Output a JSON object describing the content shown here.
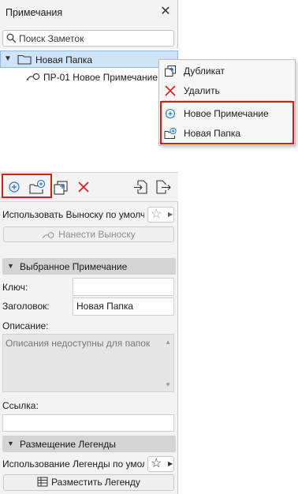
{
  "panel": {
    "title": "Примечания",
    "close_icon": "close-icon",
    "search": {
      "placeholder": "Поиск Заметок",
      "value": ""
    }
  },
  "tree": {
    "folder": {
      "label": "Новая Папка",
      "expanded": true,
      "selected": true
    },
    "note": {
      "label": "ПР-01 Новое Примечание"
    }
  },
  "context_menu": {
    "items": [
      {
        "label": "Дубликат",
        "icon": "duplicate-icon"
      },
      {
        "label": "Удалить",
        "icon": "delete-icon"
      },
      {
        "label": "Новое Примечание",
        "icon": "new-note-icon"
      },
      {
        "label": "Новая Папка",
        "icon": "new-folder-icon"
      }
    ]
  },
  "toolbar": {
    "icons": [
      "new-note-icon",
      "new-folder-icon",
      "duplicate-icon",
      "delete-icon",
      "import-icon",
      "export-icon"
    ]
  },
  "callout": {
    "default_text": "Использовать Выноску по умолчанию",
    "button_label": "Нанести Выноску"
  },
  "selected_note": {
    "section_title": "Выбранное Примечание",
    "key_label": "Ключ:",
    "key_value": "",
    "title_label": "Заголовок:",
    "title_value": "Новая Папка",
    "description_label": "Описание:",
    "description_text": "Описания недоступны для папок",
    "link_label": "Ссылка:",
    "link_value": ""
  },
  "legend": {
    "section_title": "Размещение Легенды",
    "default_text": "Использование Легенды по умолчанию",
    "button_label": "Разместить Легенду"
  },
  "colors": {
    "highlight_red": "#d7191c",
    "selection_blue": "#cfe4f7",
    "icon_blue": "#1a73c9"
  }
}
